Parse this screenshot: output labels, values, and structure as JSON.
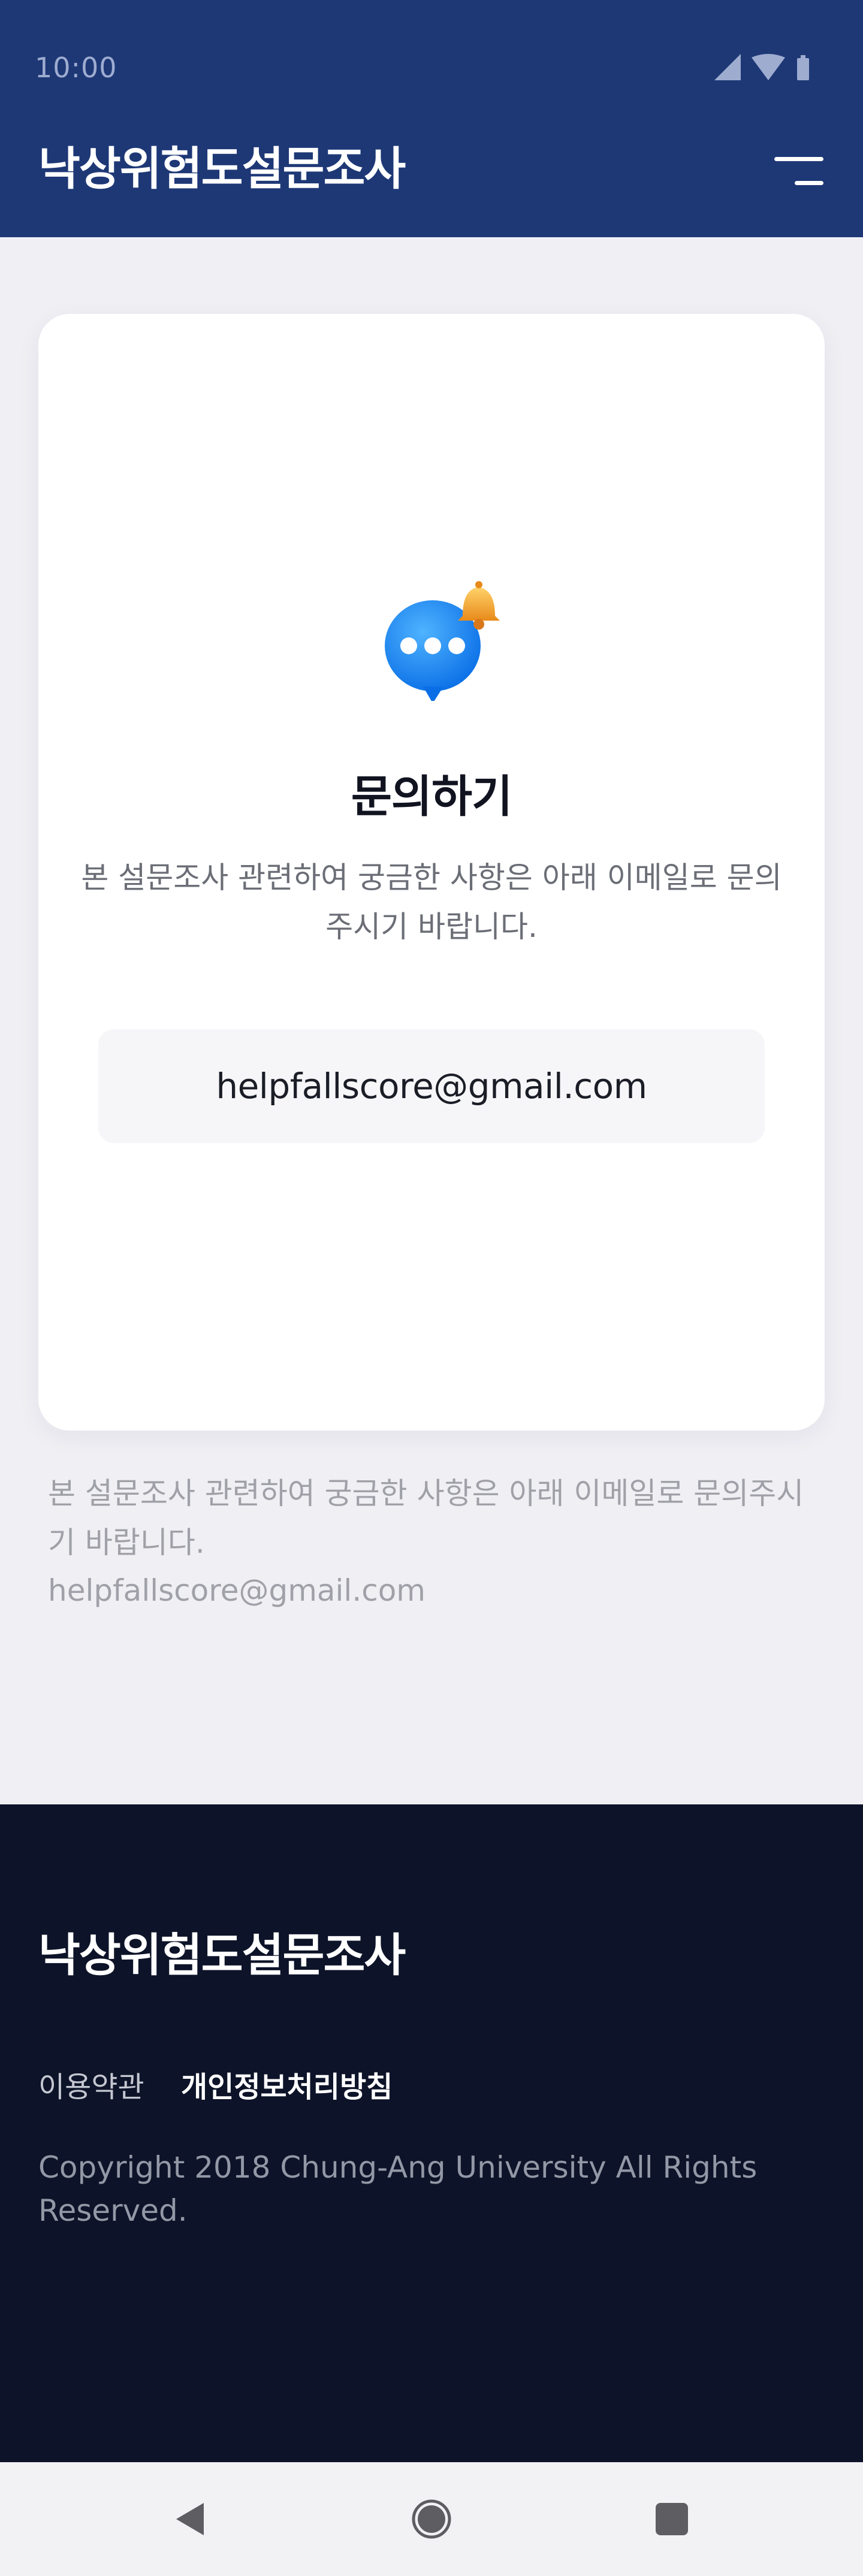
{
  "status_bar": {
    "time": "10:00",
    "icons": [
      "cellular-signal-icon",
      "wifi-icon",
      "battery-icon"
    ]
  },
  "header": {
    "title": "낙상위험도설문조사",
    "menu_icon": "menu-icon"
  },
  "card": {
    "icon": "chat-bubble-bell-icon",
    "title": "문의하기",
    "description": "본 설문조사 관련하여 궁금한 사항은 아래 이메일로 문의주시기 바랍니다.",
    "email": "helpfallscore@gmail.com"
  },
  "info": {
    "text": "본 설문조사 관련하여 궁금한 사항은 아래 이메일로 문의주시기 바랍니다.",
    "email": "helpfallscore@gmail.com"
  },
  "footer": {
    "title": "낙상위험도설문조사",
    "links": {
      "terms": "이용약관",
      "privacy": "개인정보처리방침"
    },
    "copyright": "Copyright 2018 Chung-Ang University All Rights Reserved."
  },
  "nav_bar": {
    "icons": [
      "back-icon",
      "home-icon",
      "recents-icon"
    ]
  },
  "colors": {
    "header_bg": "#1e3876",
    "footer_bg": "#0d1328",
    "page_bg": "#f0eff4",
    "accent_blue": "#1e90ff",
    "bell_orange": "#f2a93b"
  }
}
